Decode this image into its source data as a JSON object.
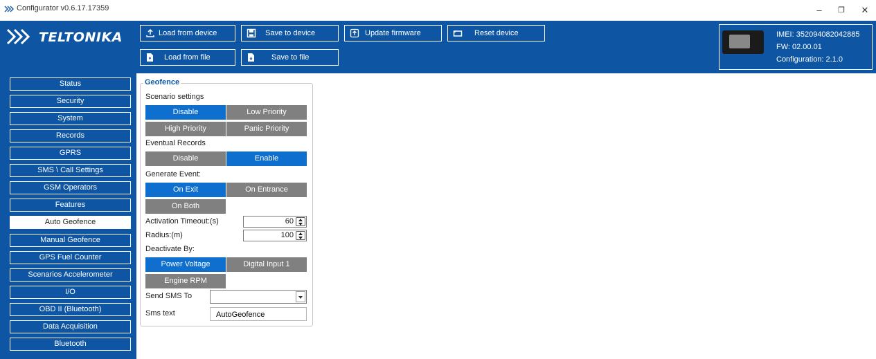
{
  "window": {
    "title": "Configurator v0.6.17.17359",
    "minimize": "–",
    "restore": "❐",
    "close": "✕"
  },
  "brand": {
    "logo_text": "TELTONIKA",
    "color": "#0e56a3"
  },
  "toolbar": {
    "load_device": "Load from device",
    "save_device": "Save to device",
    "update_fw": "Update firmware",
    "reset": "Reset device",
    "load_file": "Load from file",
    "save_file": "Save to file"
  },
  "device": {
    "imei": "IMEI: 352094082042885",
    "fw": "FW: 02.00.01",
    "config": "Configuration: 2.1.0"
  },
  "sidebar": {
    "items": [
      {
        "label": "Status"
      },
      {
        "label": "Security"
      },
      {
        "label": "System"
      },
      {
        "label": "Records"
      },
      {
        "label": "GPRS"
      },
      {
        "label": "SMS \\ Call Settings"
      },
      {
        "label": "GSM Operators"
      },
      {
        "label": "Features"
      },
      {
        "label": "Auto Geofence"
      },
      {
        "label": "Manual Geofence"
      },
      {
        "label": "GPS Fuel Counter"
      },
      {
        "label": "Scenarios Accelerometer"
      },
      {
        "label": "I/O"
      },
      {
        "label": "OBD II (Bluetooth)"
      },
      {
        "label": "Data Acquisition"
      },
      {
        "label": "Bluetooth"
      }
    ],
    "active": "Auto Geofence"
  },
  "geofence": {
    "title": "Geofence",
    "scenario": {
      "label": "Scenario settings",
      "disable": "Disable",
      "low": "Low Priority",
      "high": "High Priority",
      "panic": "Panic Priority",
      "selected": "Disable"
    },
    "eventual": {
      "label": "Eventual Records",
      "disable": "Disable",
      "enable": "Enable",
      "selected": "Enable"
    },
    "generate": {
      "label": "Generate Event:",
      "exit": "On Exit",
      "entrance": "On Entrance",
      "both": "On Both",
      "selected": "On Exit"
    },
    "timeout": {
      "label": "Activation Timeout:(s)",
      "value": "60"
    },
    "radius": {
      "label": "Radius:(m)",
      "value": "100"
    },
    "deactivate": {
      "label": "Deactivate By:",
      "power": "Power Voltage",
      "din": "Digital Input 1",
      "rpm": "Engine RPM",
      "selected": "Power Voltage"
    },
    "sms_to": {
      "label": "Send SMS To",
      "value": ""
    },
    "sms_text": {
      "label": "Sms text",
      "value": "AutoGeofence"
    }
  }
}
